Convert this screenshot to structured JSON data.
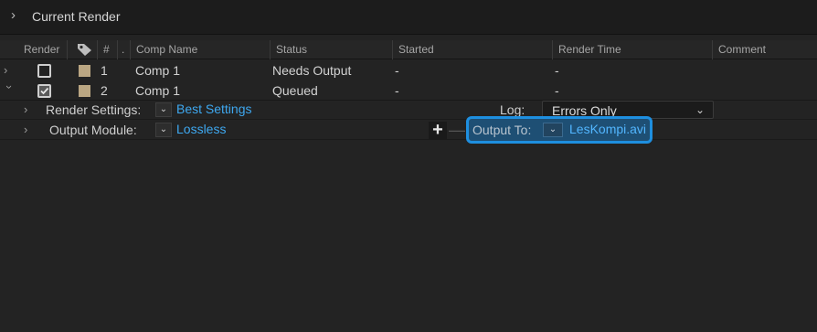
{
  "panel": {
    "title": "Current Render"
  },
  "columns": [
    "Render",
    "#",
    ".",
    "Comp Name",
    "Status",
    "Started",
    "Render Time",
    "Comment"
  ],
  "rows": [
    {
      "num": "1",
      "comp": "Comp 1",
      "status": "Needs Output",
      "started": "-",
      "render_time": "-",
      "checked": false,
      "expanded": false
    },
    {
      "num": "2",
      "comp": "Comp 1",
      "status": "Queued",
      "started": "-",
      "render_time": "-",
      "checked": true,
      "expanded": true
    }
  ],
  "render_settings": {
    "label": "Render Settings:",
    "value": "Best Settings"
  },
  "output_module": {
    "label": "Output Module:",
    "value": "Lossless"
  },
  "log": {
    "label": "Log:",
    "value": "Errors Only"
  },
  "output_to": {
    "label": "Output To:",
    "file": "LesKompi.avi"
  },
  "colors": {
    "accent": "#1e8fe0",
    "link": "#3ea8f0",
    "label_swatch": "#bba783",
    "background": "#232323"
  },
  "icons": {
    "expand": "chevron-right-icon",
    "collapse": "chevron-down-icon",
    "tag": "tag-icon",
    "add": "plus-icon",
    "remove": "minus-icon"
  }
}
